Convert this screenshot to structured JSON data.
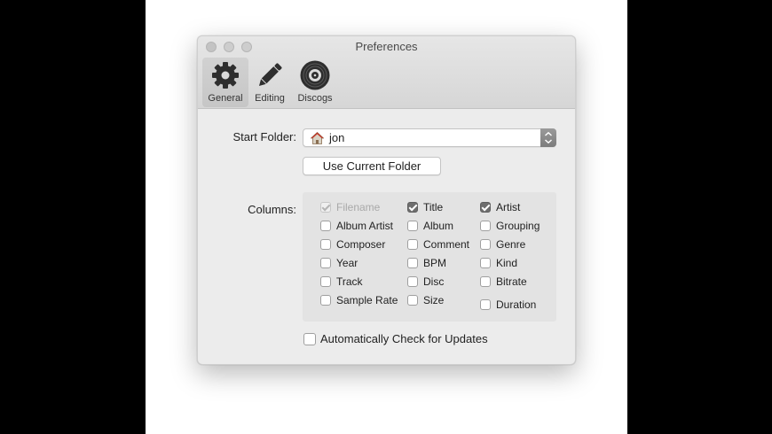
{
  "window": {
    "title": "Preferences"
  },
  "toolbar": {
    "items": [
      {
        "label": "General",
        "icon": "gear-icon",
        "active": true
      },
      {
        "label": "Editing",
        "icon": "pencil-icon",
        "active": false
      },
      {
        "label": "Discogs",
        "icon": "vinyl-record-icon",
        "active": false
      }
    ]
  },
  "general": {
    "start_folder_label": "Start Folder:",
    "start_folder_value": "jon",
    "start_folder_icon": "home-icon",
    "use_current_folder_label": "Use Current Folder",
    "columns_label": "Columns:",
    "columns": [
      {
        "label": "Filename",
        "checked": true,
        "disabled": true
      },
      {
        "label": "Title",
        "checked": true,
        "disabled": false
      },
      {
        "label": "Artist",
        "checked": true,
        "disabled": false
      },
      {
        "label": "Album Artist",
        "checked": false,
        "disabled": false
      },
      {
        "label": "Album",
        "checked": false,
        "disabled": false
      },
      {
        "label": "Grouping",
        "checked": false,
        "disabled": false
      },
      {
        "label": "Composer",
        "checked": false,
        "disabled": false
      },
      {
        "label": "Comment",
        "checked": false,
        "disabled": false
      },
      {
        "label": "Genre",
        "checked": false,
        "disabled": false
      },
      {
        "label": "Year",
        "checked": false,
        "disabled": false
      },
      {
        "label": "BPM",
        "checked": false,
        "disabled": false
      },
      {
        "label": "Kind",
        "checked": false,
        "disabled": false
      },
      {
        "label": "Track",
        "checked": false,
        "disabled": false
      },
      {
        "label": "Disc",
        "checked": false,
        "disabled": false
      },
      {
        "label": "Bitrate",
        "checked": false,
        "disabled": false
      },
      {
        "label": "Sample Rate",
        "checked": false,
        "disabled": false
      },
      {
        "label": "Size",
        "checked": false,
        "disabled": false
      },
      {
        "label": "Duration",
        "checked": false,
        "disabled": false
      }
    ],
    "auto_update_label": "Automatically Check for Updates",
    "auto_update_checked": false
  },
  "colors": {
    "window_bg": "#ececec",
    "checkbox_checked": "#6e6e6e"
  }
}
